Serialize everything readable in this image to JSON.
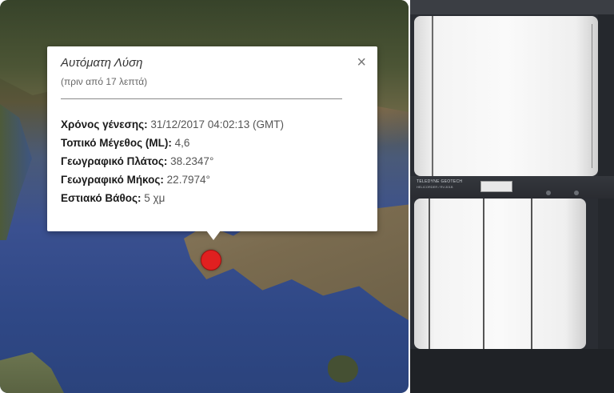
{
  "popup": {
    "title": "Αυτόματη Λύση",
    "subtitle": "(πριν από 17 λεπτά)",
    "close_glyph": "×",
    "rows": [
      {
        "label": "Χρόνος γένεσης:",
        "value": "31/12/2017  04:02:13 (GMT)"
      },
      {
        "label": "Τοπικό Μέγεθος (ML):",
        "value": "4,6"
      },
      {
        "label": "Γεωγραφικό Πλάτος:",
        "value": "38.2347°"
      },
      {
        "label": "Γεωγραφικό Μήκος:",
        "value": "22.7974°"
      },
      {
        "label": "Εστιακό Βάθος:",
        "value": "5 χμ"
      }
    ]
  },
  "marker": {
    "icon": "epicenter-marker-icon",
    "color": "#e02020"
  },
  "photo": {
    "label_line1": "TELEDYNE GEOTECH",
    "label_line2": "HELICORDER / RV-301B"
  }
}
